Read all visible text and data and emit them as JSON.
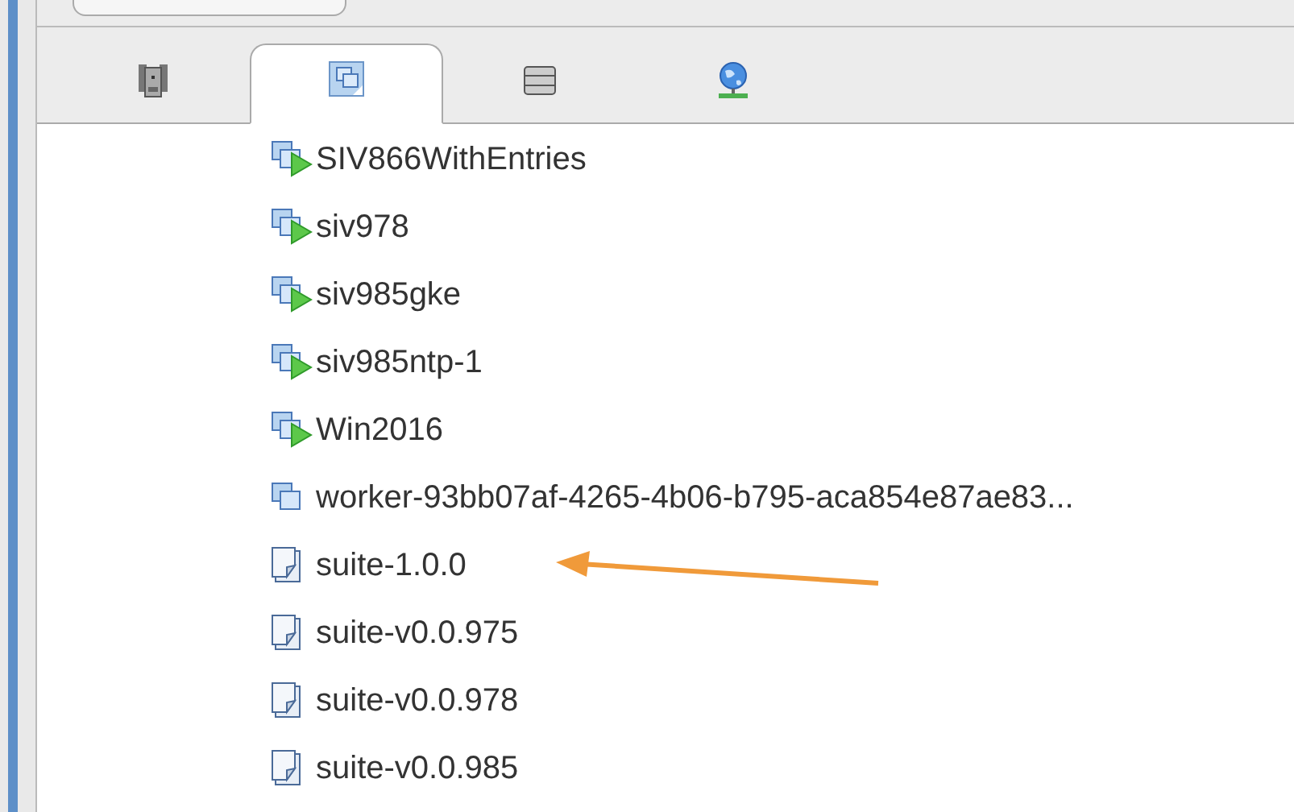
{
  "tabs": [
    {
      "kind": "hosts",
      "selected": false
    },
    {
      "kind": "vms",
      "selected": true
    },
    {
      "kind": "storage",
      "selected": false
    },
    {
      "kind": "networks",
      "selected": false
    }
  ],
  "items": [
    {
      "name": "SIV866WithEntries",
      "kind": "vm-running"
    },
    {
      "name": "siv978",
      "kind": "vm-running"
    },
    {
      "name": "siv985gke",
      "kind": "vm-running"
    },
    {
      "name": "siv985ntp-1",
      "kind": "vm-running"
    },
    {
      "name": "Win2016",
      "kind": "vm-running"
    },
    {
      "name": "worker-93bb07af-4265-4b06-b795-aca854e87ae83...",
      "kind": "vm"
    },
    {
      "name": "suite-1.0.0",
      "kind": "template"
    },
    {
      "name": "suite-v0.0.975",
      "kind": "template"
    },
    {
      "name": "suite-v0.0.978",
      "kind": "template"
    },
    {
      "name": "suite-v0.0.985",
      "kind": "template"
    }
  ]
}
